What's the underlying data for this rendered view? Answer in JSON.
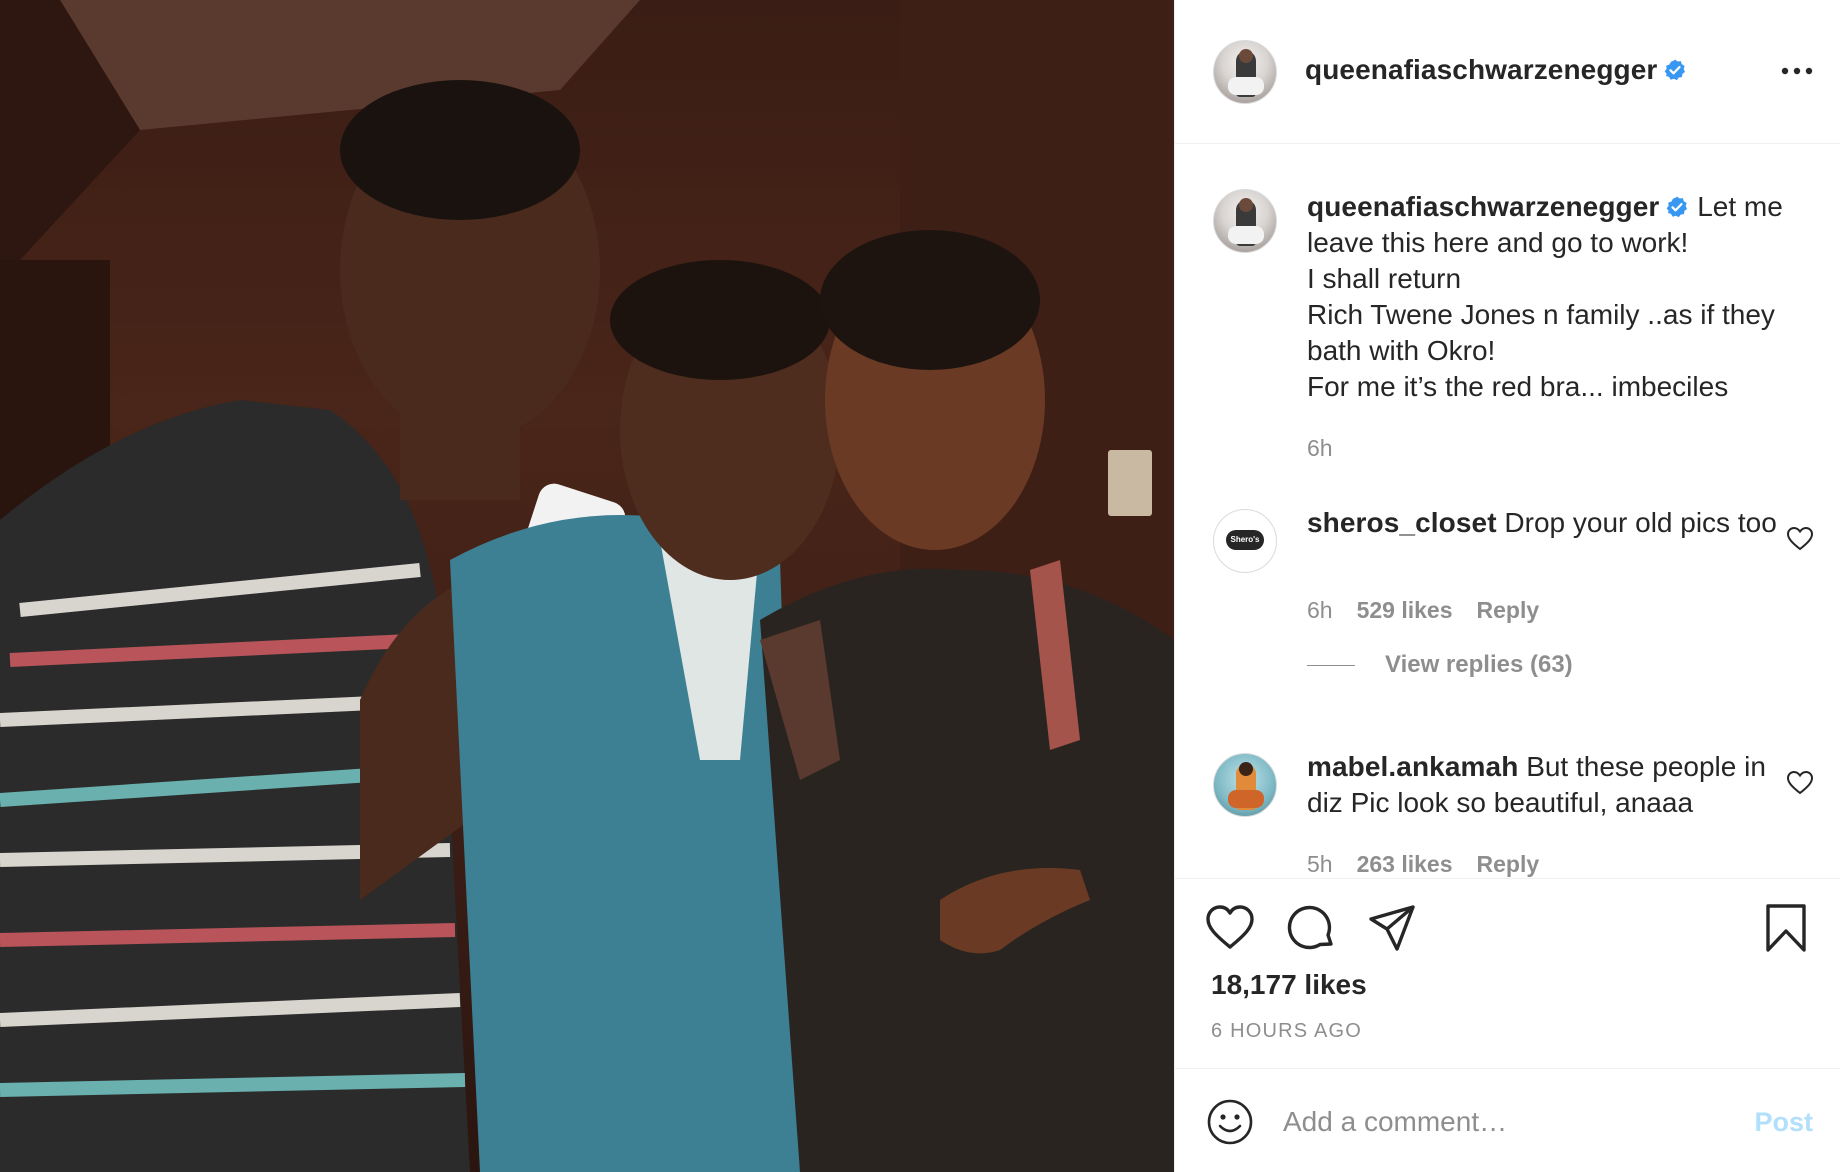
{
  "header": {
    "username": "queenafiaschwarzenegger",
    "verified": true,
    "more_icon": "more-horizontal-icon"
  },
  "caption": {
    "username": "queenafiaschwarzenegger",
    "text": "Let me leave this here and go to work!\nI shall return\nRich Twene Jones n family ..as if they bath with Okro!\nFor me it’s the red bra... imbeciles",
    "time": "6h"
  },
  "comments": [
    {
      "username": "sheros_closet",
      "text": "Drop your old pics too",
      "time": "6h",
      "likes": "529 likes",
      "reply": "Reply",
      "view_replies": "View replies (63)",
      "avatar_text": "Shero's Closet"
    },
    {
      "username": "mabel.ankamah",
      "text": "But these people in diz Pic look so beautiful, anaaa",
      "time": "5h",
      "likes": "263 likes",
      "reply": "Reply"
    }
  ],
  "actions": {
    "like_icon": "heart-icon",
    "comment_icon": "comment-icon",
    "share_icon": "send-icon",
    "save_icon": "bookmark-icon",
    "likes_count": "18,177 likes",
    "posted_ago": "6 HOURS AGO"
  },
  "composer": {
    "placeholder": "Add a comment…",
    "post_label": "Post",
    "emoji_icon": "emoji-icon"
  },
  "colors": {
    "verified_blue": "#3897f0",
    "post_disabled": "#b2dffc",
    "text_primary": "#262626",
    "text_secondary": "#8e8e8e"
  }
}
